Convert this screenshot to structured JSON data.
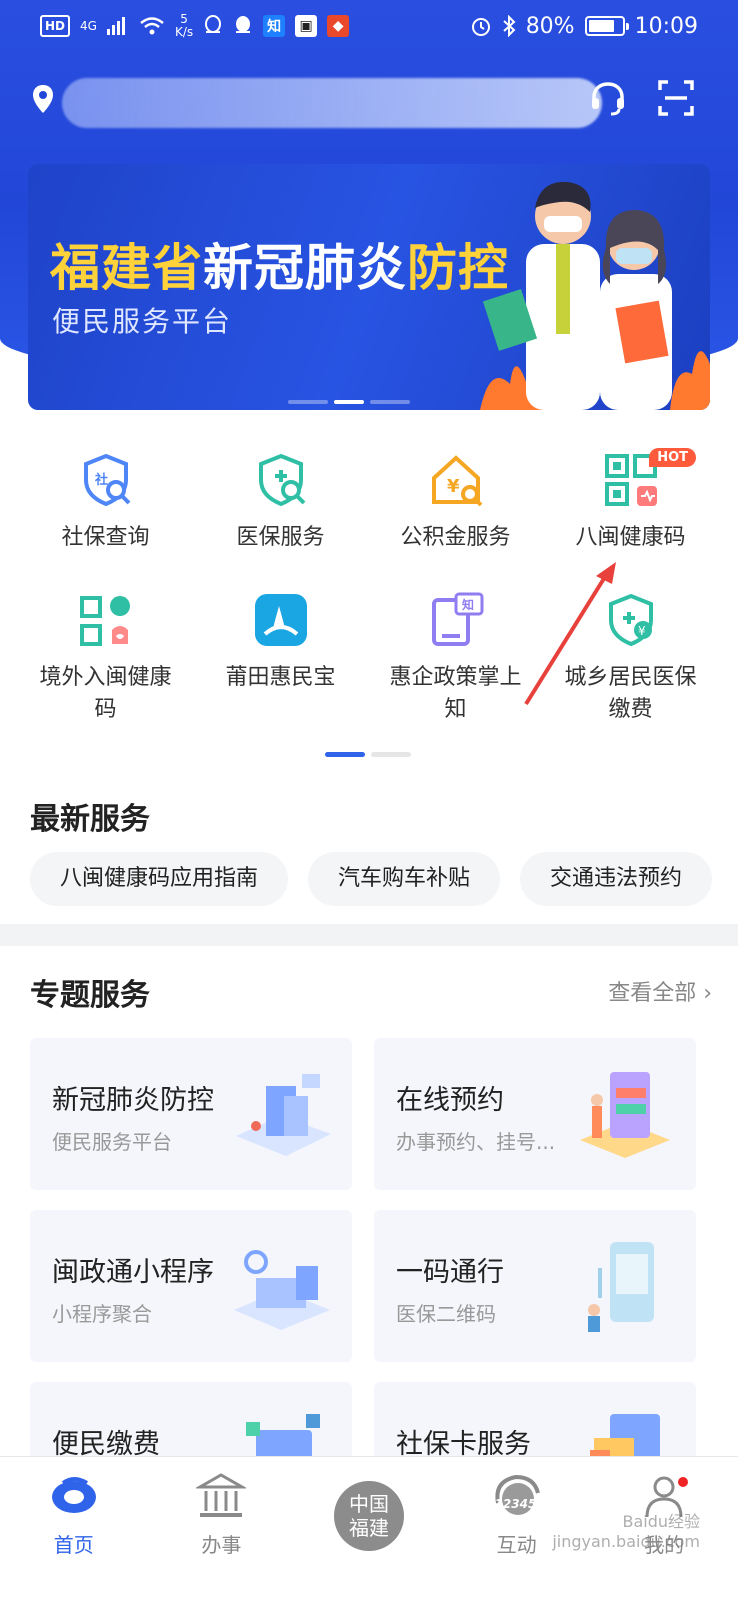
{
  "status_bar": {
    "hd": "HD",
    "network": "4G",
    "speed_value": "5",
    "speed_unit": "K/s",
    "app_icons": [
      "qq-icon",
      "qq-icon",
      "zhihu-icon",
      "news-icon",
      "app-icon"
    ],
    "app_zhihu": "知",
    "battery": "80%",
    "time": "10:09",
    "colors": {
      "text": "#ffffff"
    }
  },
  "header": {
    "location_icon": "location-pin-icon",
    "search_placeholder": "",
    "service_icon": "headset-icon",
    "scan_icon": "scan-icon"
  },
  "banner": {
    "title_part1": "福建省",
    "title_part2": "新冠肺炎",
    "title_part3": "防控",
    "subtitle": "便民服务平台",
    "active_slide": 2,
    "slides": 3
  },
  "services": [
    {
      "label": "社保查询",
      "icon": "social-security-search-icon"
    },
    {
      "label": "医保服务",
      "icon": "medical-insurance-icon"
    },
    {
      "label": "公积金服务",
      "icon": "housing-fund-icon"
    },
    {
      "label": "八闽健康码",
      "icon": "health-qr-code-icon",
      "badge": "HOT"
    },
    {
      "label": "境外入闽健康码",
      "icon": "overseas-health-code-icon"
    },
    {
      "label": "莆田惠民宝",
      "icon": "putian-app-icon"
    },
    {
      "label": "惠企政策掌上知",
      "icon": "policy-knowledge-icon"
    },
    {
      "label": "城乡居民医保缴费",
      "icon": "medical-payment-icon"
    }
  ],
  "latest": {
    "title": "最新服务",
    "chips": [
      "八闽健康码应用指南",
      "汽车购车补贴",
      "交通违法预约"
    ]
  },
  "topics": {
    "title": "专题服务",
    "see_all": "查看全部 ›",
    "cards": [
      {
        "title": "新冠肺炎防控",
        "subtitle": "便民服务平台"
      },
      {
        "title": "在线预约",
        "subtitle": "办事预约、挂号..."
      },
      {
        "title": "闽政通小程序",
        "subtitle": "小程序聚合"
      },
      {
        "title": "一码通行",
        "subtitle": "医保二维码"
      },
      {
        "title": "便民缴费",
        "subtitle": ""
      },
      {
        "title": "社保卡服务",
        "subtitle": ""
      }
    ]
  },
  "tabbar": {
    "home": "首页",
    "affairs": "办事",
    "center_line1": "中国",
    "center_line2": "福建",
    "interact": "互动",
    "interact_badge": "12345",
    "mine": "我的"
  },
  "watermark": {
    "line1": "Baidu经验",
    "line2": "jingyan.baidu.com"
  },
  "colors": {
    "brand_blue": "#2f63ea",
    "banner_yellow": "#ffd23a",
    "hot_badge": "#ff5a3c",
    "notify_dot": "#f02424"
  }
}
